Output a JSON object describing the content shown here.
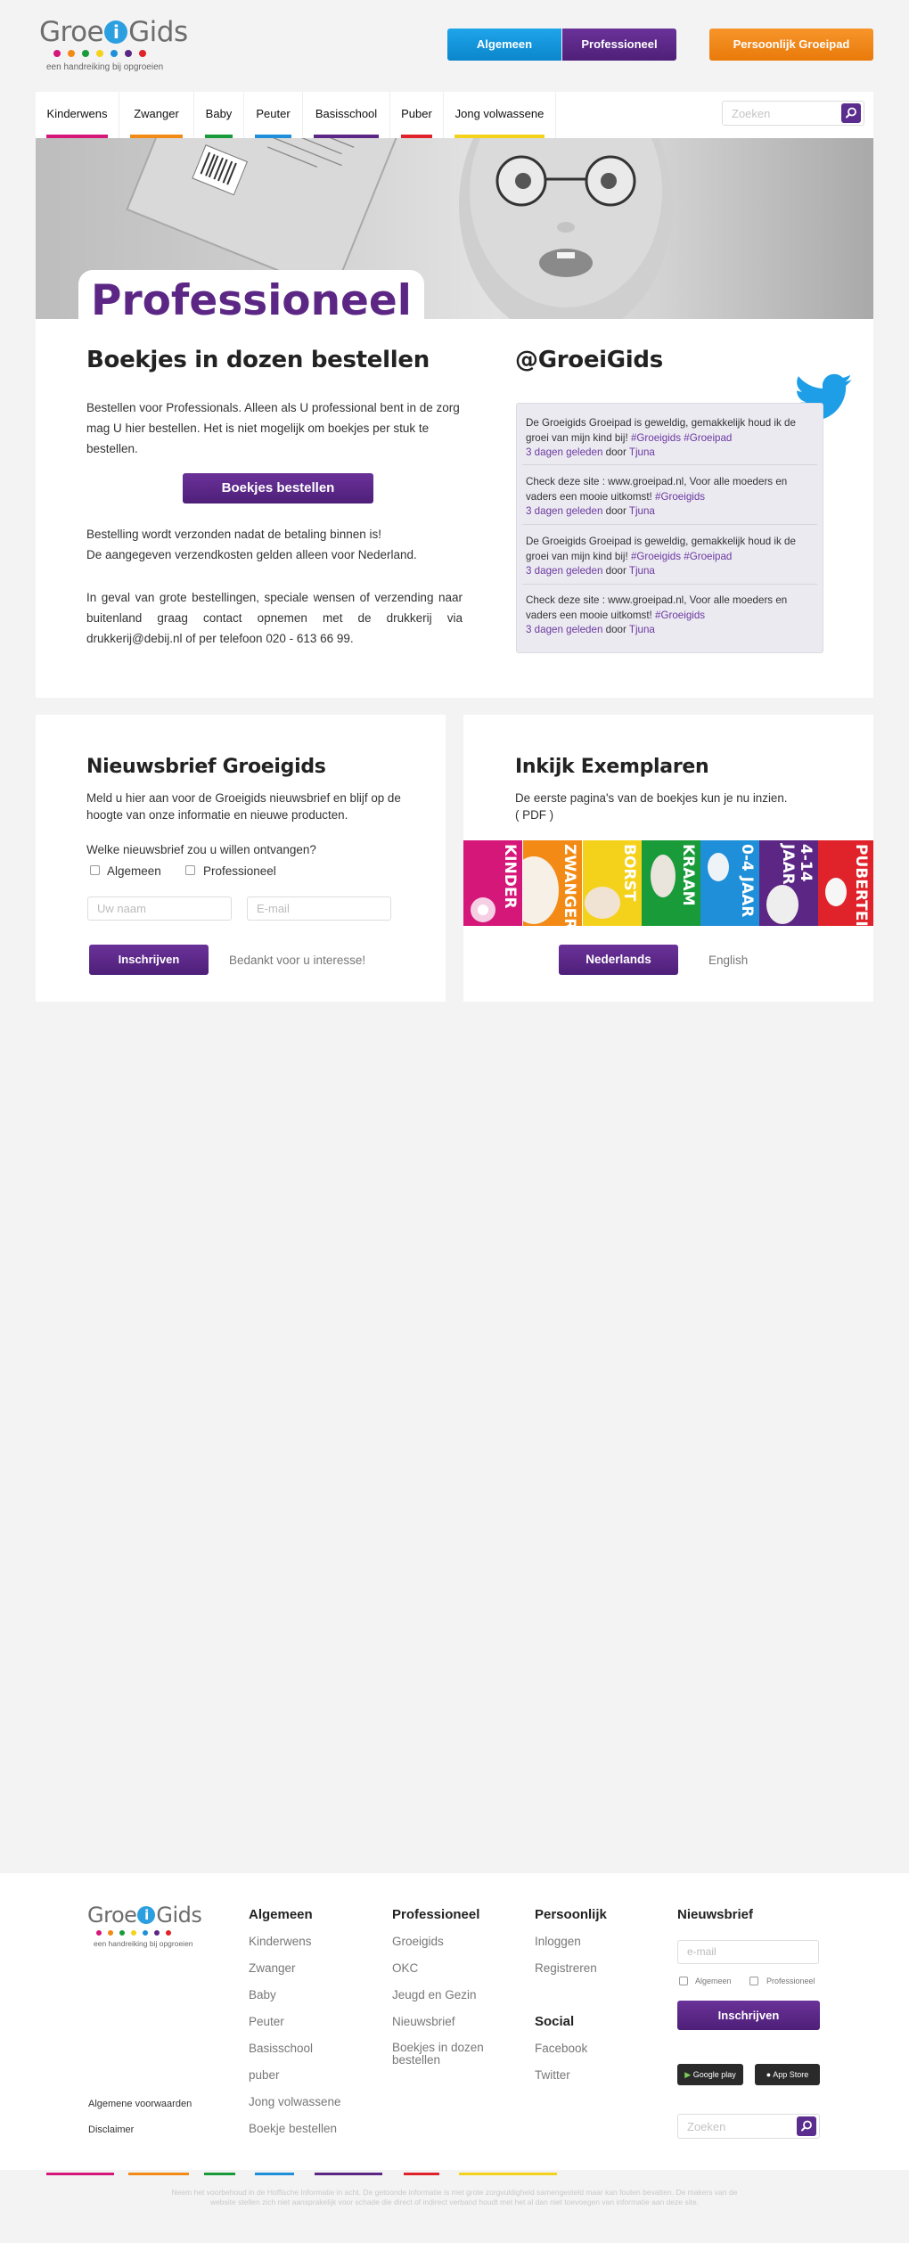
{
  "header": {
    "logo": {
      "part1": "Groe",
      "i": "i",
      "part2": "Gids",
      "tagline": "een handreiking bij opgroeien"
    },
    "buttons": {
      "algemeen": "Algemeen",
      "professioneel": "Professioneel",
      "groeipad": "Persoonlijk Groeipad"
    }
  },
  "brand_colors": {
    "magenta": "#d6177a",
    "orange": "#f28a15",
    "green": "#1a9b3a",
    "blue": "#1e8fd8",
    "purple": "#5c2784",
    "red": "#e0232a",
    "yellow": "#f4d21b"
  },
  "nav": {
    "items": [
      {
        "label": "Kinderwens",
        "color": "#d6177a"
      },
      {
        "label": "Zwanger",
        "color": "#f28a15"
      },
      {
        "label": "Baby",
        "color": "#1a9b3a"
      },
      {
        "label": "Peuter",
        "color": "#1e8fd8"
      },
      {
        "label": "Basisschool",
        "color": "#5c2784"
      },
      {
        "label": "Puber",
        "color": "#e0232a"
      },
      {
        "label": "Jong volwassene",
        "color": "#f4d21b"
      }
    ],
    "search_placeholder": "Zoeken",
    "search_icon": "search-icon"
  },
  "hero": {
    "title": "Professioneel"
  },
  "order": {
    "title": "Boekjes in dozen bestellen",
    "intro": "Bestellen voor Professionals. Alleen als U professional bent in de zorg mag U hier bestellen. Het is niet mogelijk om boekjes per stuk te bestellen.",
    "button": "Boekjes bestellen",
    "note1": "Bestelling wordt verzonden nadat de betaling binnen is!",
    "note2": "De aangegeven verzendkosten gelden alleen voor Nederland.",
    "contact": "In geval van grote bestellingen, speciale wensen of verzending naar buitenland graag contact opnemen met de drukkerij via drukkerij@debij.nl of per telefoon 020 - 613 66 99."
  },
  "twitter": {
    "handle": "@GroeiGids",
    "icon": "twitter-bird-icon",
    "tweets": [
      {
        "text": "De Groeigids Groeipad is geweldig, gemakkelijk houd ik de groei van mijn kind bij!",
        "tags": "#Groeigids #Groeipad",
        "time": "3 dagen geleden",
        "by": "door",
        "user": "Tjuna"
      },
      {
        "text": "Check deze site : www.groeipad.nl, Voor alle moeders en vaders een mooie uitkomst!",
        "tags": "#Groeigids",
        "time": "3 dagen geleden",
        "by": "door",
        "user": "Tjuna"
      },
      {
        "text": "De Groeigids Groeipad is geweldig, gemakkelijk houd ik de groei van mijn kind bij!",
        "tags": "#Groeigids #Groeipad",
        "time": "3 dagen geleden",
        "by": "door",
        "user": "Tjuna"
      },
      {
        "text": "Check deze site : www.groeipad.nl, Voor alle moeders en vaders een mooie uitkomst!",
        "tags": "#Groeigids",
        "time": "3 dagen geleden",
        "by": "door",
        "user": "Tjuna"
      }
    ]
  },
  "newsletter": {
    "title": "Nieuwsbrief Groeigids",
    "intro": "Meld u hier aan voor de Groeigids nieuwsbrief en blijf op de hoogte van onze informatie en nieuwe producten.",
    "question": "Welke nieuwsbrief zou u willen ontvangen?",
    "options": [
      "Algemeen",
      "Professioneel"
    ],
    "name_placeholder": "Uw naam",
    "email_placeholder": "E-mail",
    "button": "Inschrijven",
    "thanks": "Bedankt voor u interesse!"
  },
  "inkijk": {
    "title": "Inkijk Exemplaren",
    "intro": "De eerste pagina's van de boekjes kun je nu inzien.",
    "pdf": "( PDF )",
    "books": [
      {
        "label": "KINDER",
        "color": "#d6177a"
      },
      {
        "label": "ZWANGER",
        "color": "#f28a15"
      },
      {
        "label": "BORST",
        "color": "#f4d21b"
      },
      {
        "label": "KRAAM",
        "color": "#1a9b3a"
      },
      {
        "label": "0-4 JAAR",
        "color": "#1e8fd8"
      },
      {
        "label": "4-14 JAAR",
        "color": "#5c2784"
      },
      {
        "label": "PUBERTEIT",
        "color": "#e0232a"
      }
    ],
    "btn_nl": "Nederlands",
    "btn_en": "English"
  },
  "footer": {
    "logo_tagline": "een handreiking bij opgroeien",
    "cols": {
      "algemeen": {
        "title": "Algemeen",
        "links": [
          "Kinderwens",
          "Zwanger",
          "Baby",
          "Peuter",
          "Basisschool",
          "puber",
          "Jong volwassene",
          "Boekje bestellen"
        ]
      },
      "professioneel": {
        "title": "Professioneel",
        "links": [
          "Groeigids",
          "OKC",
          "Jeugd en Gezin",
          "Nieuwsbrief",
          "Boekjes in dozen bestellen"
        ]
      },
      "persoonlijk": {
        "title": "Persoonlijk",
        "links": [
          "Inloggen",
          "Registreren"
        ]
      },
      "social": {
        "title": "Social",
        "links": [
          "Facebook",
          "Twitter"
        ]
      }
    },
    "legal": [
      "Algemene voorwaarden",
      "Disclaimer"
    ],
    "newsletter": {
      "title": "Nieuwsbrief",
      "placeholder": "e-mail",
      "options": [
        "Algemeen",
        "Professioneel"
      ],
      "button": "Inschrijven"
    },
    "stores": {
      "google": "Google play",
      "apple": "App Store"
    },
    "search_placeholder": "Zoeken",
    "disclaimer": "Neem het voorbehoud in de Hoffische Informatie in acht. De getoonde informatie is met grote zorgvuldigheid samengesteld maar kan fouten bevatten. De makers van de website stellen zich niet aansprakelijk voor schade die direct of indirect verband houdt met het al dan niet toevoegen van informatie aan deze site."
  }
}
